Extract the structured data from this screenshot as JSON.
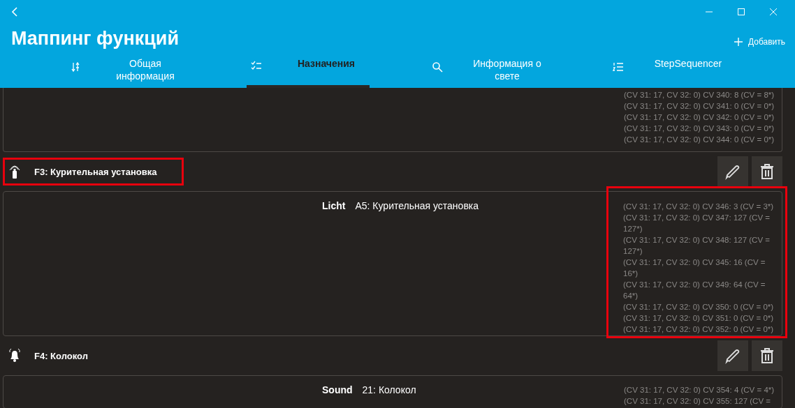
{
  "window": {
    "title": "Маппинг функций"
  },
  "add_button": {
    "label": "Добавить"
  },
  "tabs": [
    {
      "label": "Общая информация",
      "kind": "sliders",
      "selected": false
    },
    {
      "label": "Назначения",
      "kind": "checklist",
      "selected": true
    },
    {
      "label": "Информация о свете",
      "kind": "search",
      "selected": false
    },
    {
      "label": "StepSequencer",
      "kind": "numbered",
      "selected": false
    }
  ],
  "top_panel": {
    "cv_lines": [
      "(CV 31: 17, CV 32: 0) CV 340: 8 (CV = 8*)",
      "(CV 31: 17, CV 32: 0) CV 341: 0 (CV = 0*)",
      "(CV 31: 17, CV 32: 0) CV 342: 0 (CV = 0*)",
      "(CV 31: 17, CV 32: 0) CV 343: 0 (CV = 0*)",
      "(CV 31: 17, CV 32: 0) CV 344: 0 (CV = 0*)"
    ]
  },
  "functions": [
    {
      "kind": "smoke",
      "title": "F3: Курительная установка",
      "highlighted": true,
      "details": {
        "type": "Licht",
        "output": "A5: Курительная установка",
        "highlighted": true,
        "cv_lines": [
          "(CV 31: 17, CV 32: 0) CV 346: 3 (CV = 3*)",
          "(CV 31: 17, CV 32: 0) CV 347: 127 (CV = 127*)",
          "(CV 31: 17, CV 32: 0) CV 348: 127 (CV = 127*)",
          "(CV 31: 17, CV 32: 0) CV 345: 16 (CV = 16*)",
          "(CV 31: 17, CV 32: 0) CV 349: 64 (CV = 64*)",
          "(CV 31: 17, CV 32: 0) CV 350: 0 (CV = 0*)",
          "(CV 31: 17, CV 32: 0) CV 351: 0 (CV = 0*)",
          "(CV 31: 17, CV 32: 0) CV 352: 0 (CV = 0*)"
        ]
      }
    },
    {
      "kind": "bell",
      "title": "F4: Колокол",
      "highlighted": false,
      "details": {
        "type": "Sound",
        "output": "21: Колокол",
        "highlighted": false,
        "cv_lines": [
          "(CV 31: 17, CV 32: 0) CV 354: 4 (CV = 4*)",
          "(CV 31: 17, CV 32: 0) CV 355: 127 (CV ="
        ]
      }
    }
  ]
}
